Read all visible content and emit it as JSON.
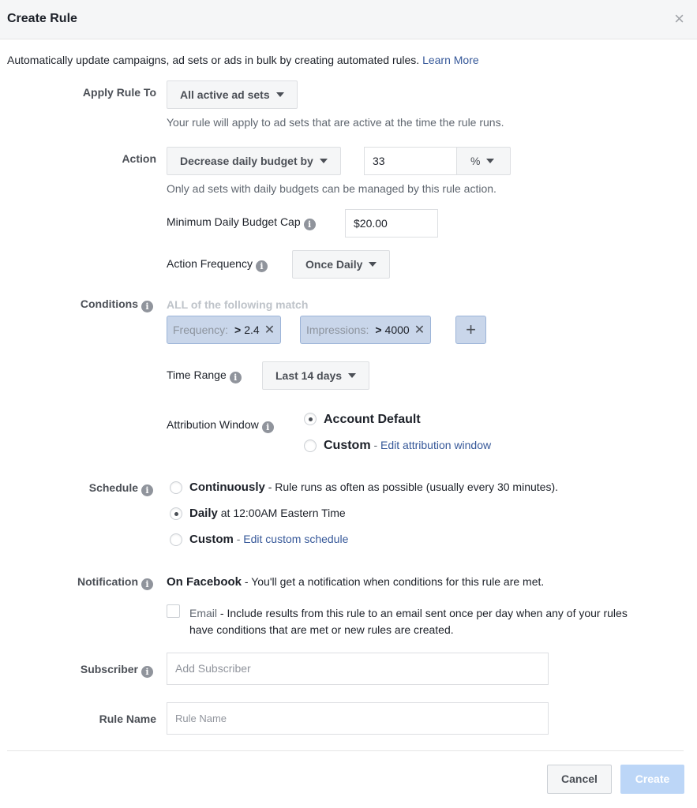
{
  "dialog": {
    "title": "Create Rule",
    "close_icon": "×",
    "intro_text": "Automatically update campaigns, ad sets or ads in bulk by creating automated rules.",
    "learn_more": "Learn More"
  },
  "apply_rule_to": {
    "label": "Apply Rule To",
    "value": "All active ad sets",
    "help": "Your rule will apply to ad sets that are active at the time the rule runs."
  },
  "action": {
    "label": "Action",
    "value": "Decrease daily budget by",
    "amount": "33",
    "unit": "%",
    "help": "Only ad sets with daily budgets can be managed by this rule action.",
    "min_cap_label": "Minimum Daily Budget Cap",
    "min_cap_value": "$20.00",
    "frequency_label": "Action Frequency",
    "frequency_value": "Once Daily"
  },
  "conditions": {
    "label": "Conditions",
    "match_text": "ALL of the following match",
    "items": [
      {
        "metric": "Frequency:",
        "operator": ">",
        "value": "2.4"
      },
      {
        "metric": "Impressions:",
        "operator": ">",
        "value": "4000"
      }
    ],
    "add_icon": "+",
    "remove_icon": "✕",
    "time_range_label": "Time Range",
    "time_range_value": "Last 14 days",
    "attribution_label": "Attribution Window",
    "attribution_options": [
      {
        "label": "Account Default",
        "selected": true
      },
      {
        "label": "Custom",
        "link": "Edit attribution window",
        "separator": " - ",
        "selected": false
      }
    ]
  },
  "schedule": {
    "label": "Schedule",
    "options": [
      {
        "label": "Continuously",
        "desc": " - Rule runs as often as possible (usually every 30 minutes).",
        "selected": false
      },
      {
        "label": "Daily",
        "desc": " at 12:00AM Eastern Time",
        "selected": true
      },
      {
        "label": "Custom",
        "separator": " - ",
        "link": "Edit custom schedule",
        "selected": false
      }
    ]
  },
  "notification": {
    "label": "Notification",
    "facebook_title": "On Facebook",
    "facebook_desc": " - You'll get a notification when conditions for this rule are met.",
    "email_label": "Email",
    "email_desc_line1": " - Include results from this rule to an email sent once per day when any of your rules",
    "email_desc_line2": "have conditions that are met or new rules are created.",
    "email_checked": false
  },
  "subscriber": {
    "label": "Subscriber",
    "placeholder": "Add Subscriber"
  },
  "rule_name": {
    "label": "Rule Name",
    "placeholder": "Rule Name"
  },
  "footer": {
    "cancel": "Cancel",
    "create": "Create"
  },
  "colors": {
    "link": "#365899",
    "chip_bg": "#c9d6ea",
    "create_disabled": "#bcd6f7"
  }
}
